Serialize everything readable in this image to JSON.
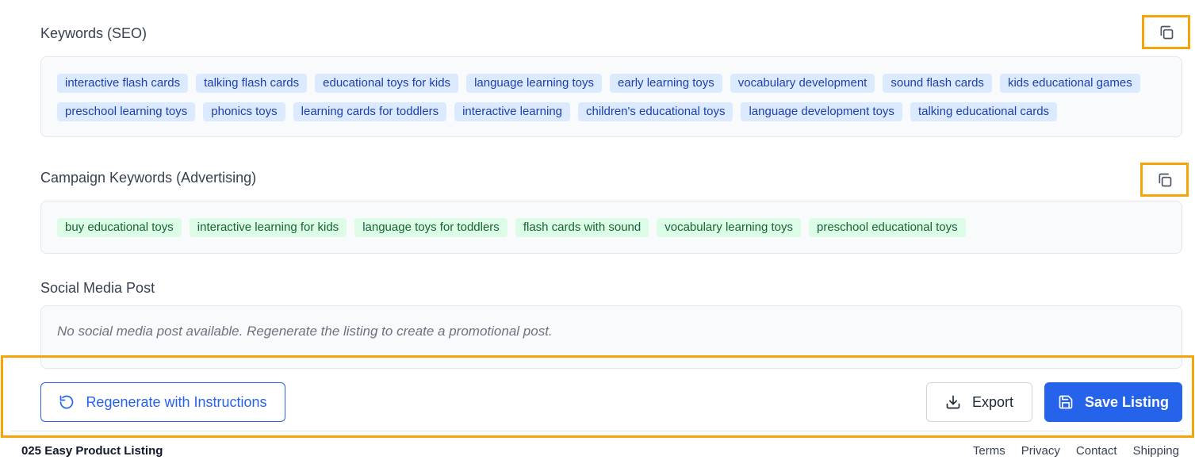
{
  "seo": {
    "title": "Keywords (SEO)",
    "keywords": [
      "interactive flash cards",
      "talking flash cards",
      "educational toys for kids",
      "language learning toys",
      "early learning toys",
      "vocabulary development",
      "sound flash cards",
      "kids educational games",
      "preschool learning toys",
      "phonics toys",
      "learning cards for toddlers",
      "interactive learning",
      "children's educational toys",
      "language development toys",
      "talking educational cards"
    ]
  },
  "campaign": {
    "title": "Campaign Keywords (Advertising)",
    "keywords": [
      "buy educational toys",
      "interactive learning for kids",
      "language toys for toddlers",
      "flash cards with sound",
      "vocabulary learning toys",
      "preschool educational toys"
    ]
  },
  "social": {
    "title": "Social Media Post",
    "placeholder": "No social media post available. Regenerate the listing to create a promotional post."
  },
  "actions": {
    "regenerate_label": "Regenerate with Instructions",
    "export_label": "Export",
    "save_label": "Save Listing"
  },
  "footer": {
    "brand": "025 Easy Product Listing",
    "links": [
      "Terms",
      "Privacy",
      "Contact",
      "Shipping"
    ]
  },
  "icons": {
    "copy": "copy-icon",
    "regenerate": "rotate-ccw-icon",
    "export": "download-icon",
    "save": "save-icon"
  },
  "colors": {
    "accent": "#2563eb",
    "highlight": "#f5a50a",
    "seo_chip_bg": "#dbeafe",
    "seo_chip_text": "#1e40af",
    "campaign_chip_bg": "#dcfce7",
    "campaign_chip_text": "#166534"
  }
}
